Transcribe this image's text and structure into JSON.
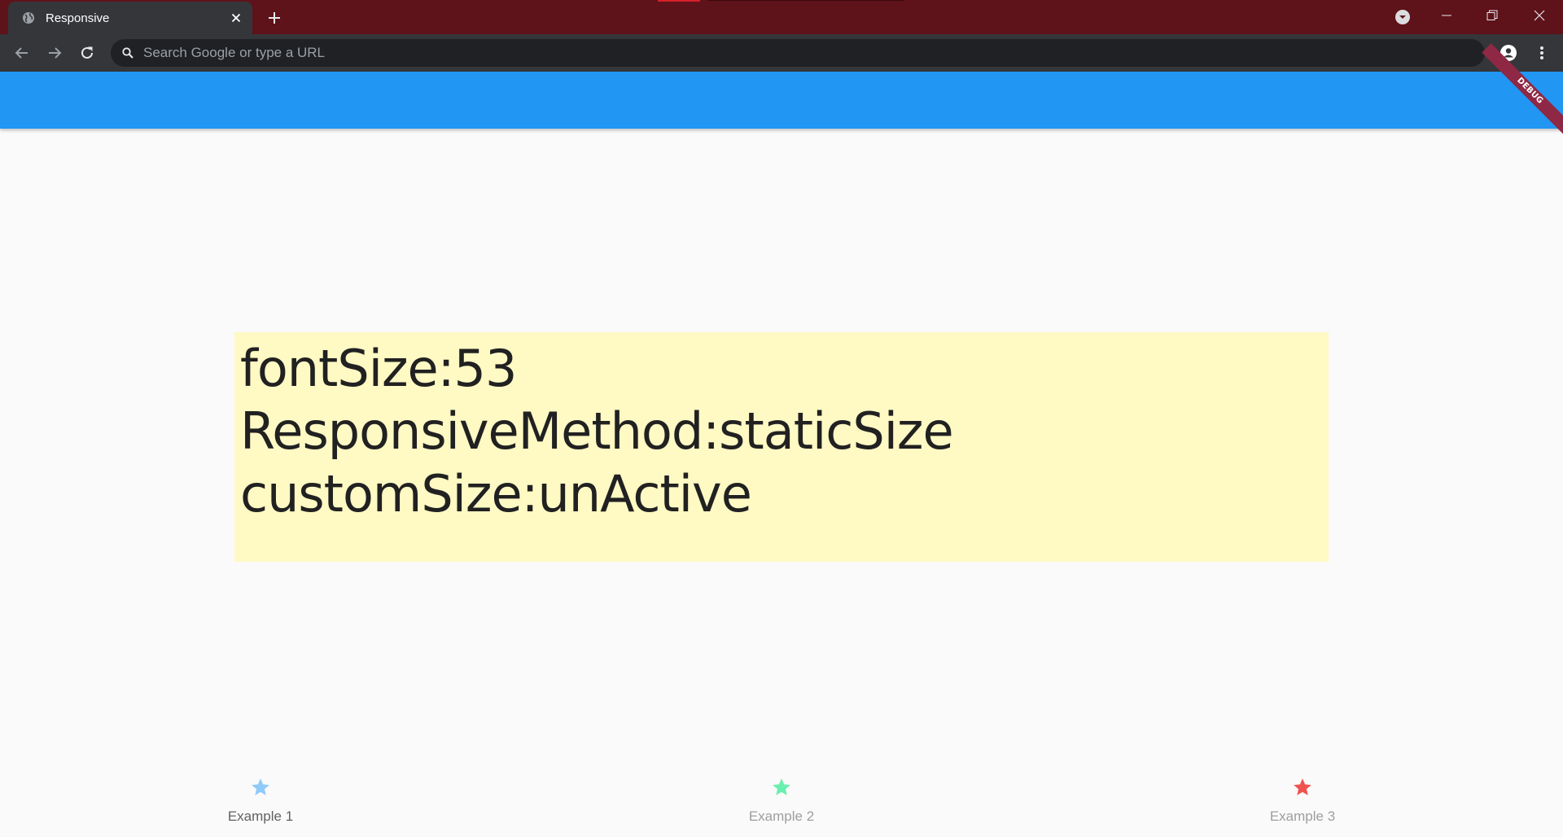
{
  "browser": {
    "tab": {
      "title": "Responsive",
      "favicon": "globe-icon",
      "close_icon": "close-icon"
    },
    "new_tab_icon": "plus-icon",
    "tab_search_icon": "chevron-down-circle-icon",
    "window_controls": [
      "minimize-icon",
      "restore-icon",
      "close-icon"
    ],
    "toolbar": {
      "back_icon": "arrow-left-icon",
      "forward_icon": "arrow-right-icon",
      "reload_icon": "reload-icon",
      "omnibox_placeholder": "Search Google or type a URL",
      "profile_icon": "account-icon",
      "menu_icon": "kebab-menu-icon"
    },
    "colors": {
      "frame": "#5e1219",
      "tab": "#35363a",
      "omnibox": "#202124"
    }
  },
  "app": {
    "appbar_color": "#2196f3",
    "debug_banner": "DEBUG",
    "box_color": "#fff9c4",
    "lines": [
      "fontSize:53",
      "ResponsiveMethod:staticSize",
      "customSize:unActive"
    ],
    "bottom_nav": [
      {
        "label": "Example 1",
        "icon": "star-icon",
        "color": "#90caf9",
        "active": true
      },
      {
        "label": "Example 2",
        "icon": "star-icon",
        "color": "#69f0ae",
        "active": false
      },
      {
        "label": "Example 3",
        "icon": "star-icon",
        "color": "#ef5350",
        "active": false
      }
    ]
  }
}
